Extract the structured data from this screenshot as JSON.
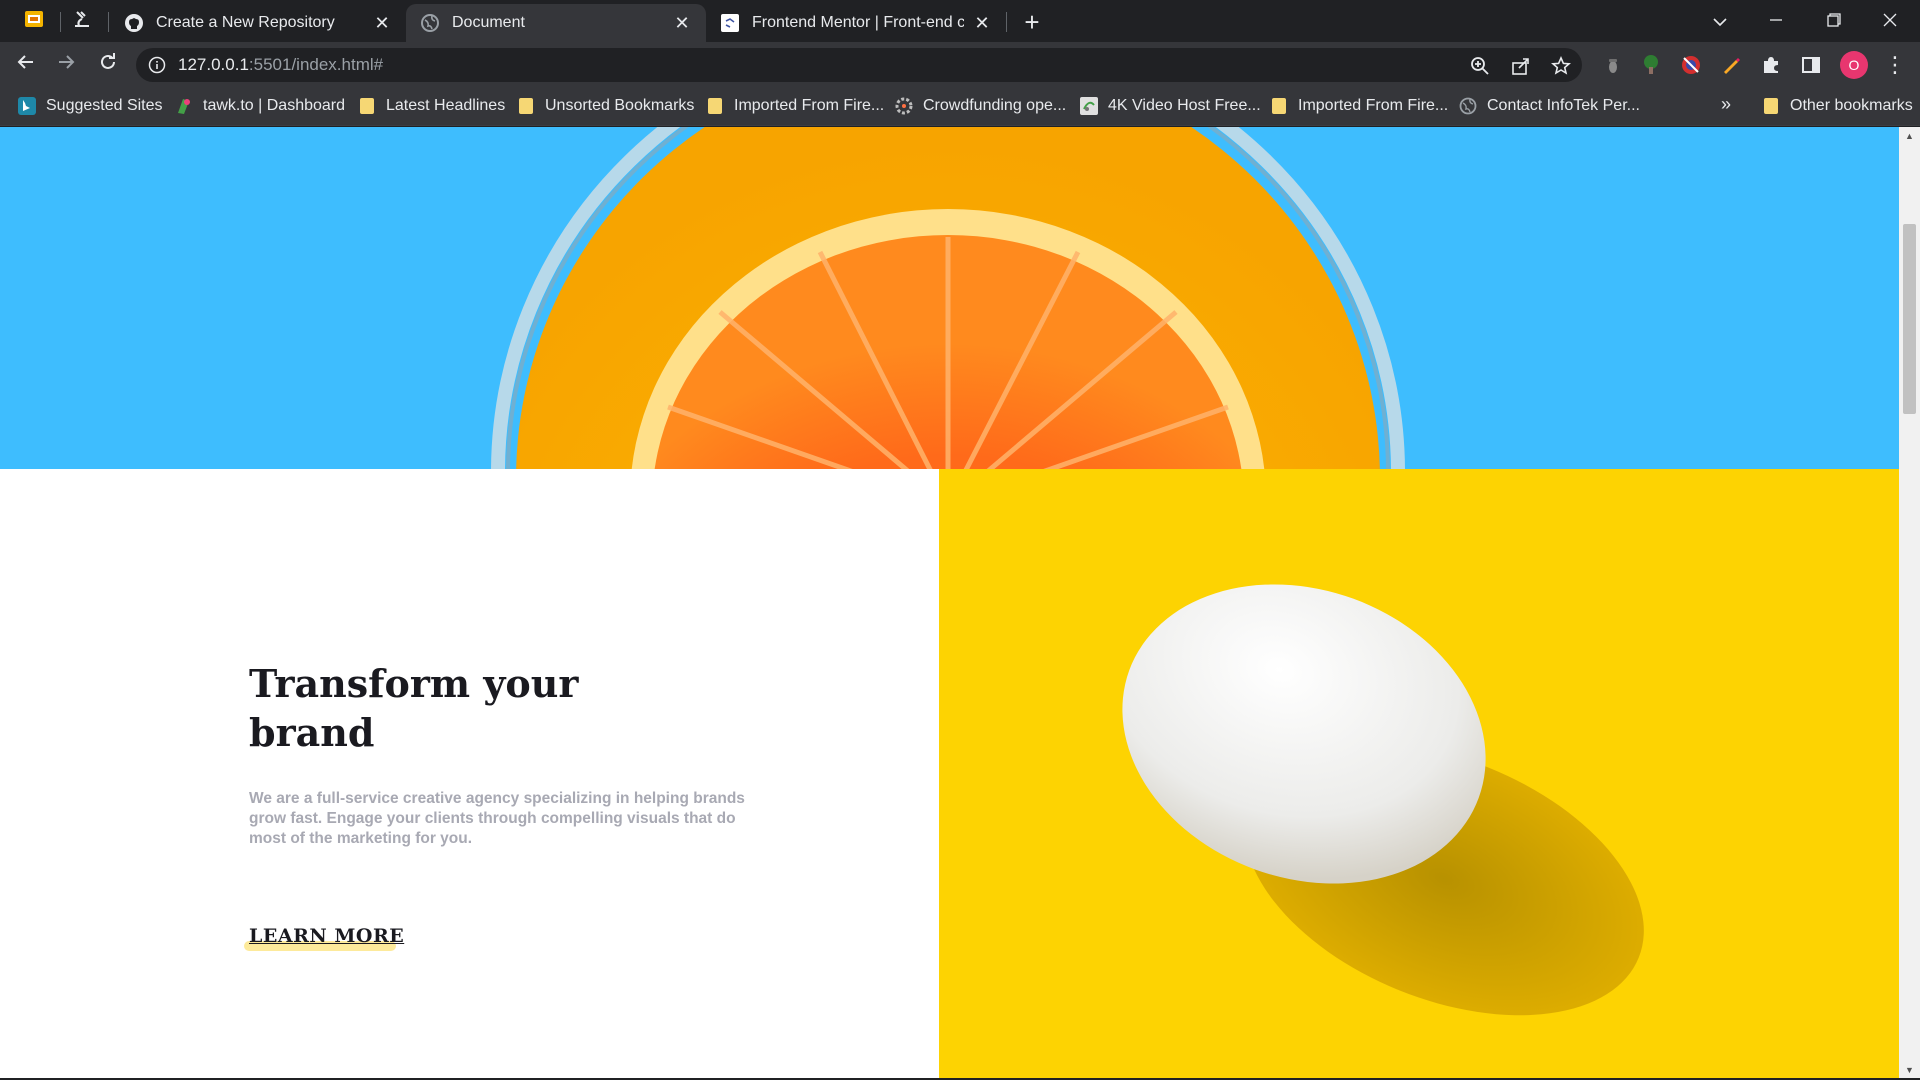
{
  "browser": {
    "tabs": [
      {
        "title": "Create a New Repository",
        "icon": "github-icon"
      },
      {
        "title": "Document",
        "icon": "globe-icon"
      },
      {
        "title": "Frontend Mentor | Front-end coc",
        "icon": "frontend-mentor-icon"
      }
    ],
    "url": {
      "host": "127.0.0.1",
      "rest": ":5501/index.html#"
    },
    "bookmarks": [
      {
        "label": "Suggested Sites",
        "icon": "bing-icon"
      },
      {
        "label": "tawk.to | Dashboard",
        "icon": "tawk-icon"
      },
      {
        "label": "Latest Headlines",
        "icon": "folder-icon"
      },
      {
        "label": "Unsorted Bookmarks",
        "icon": "folder-icon"
      },
      {
        "label": "Imported From Fire...",
        "icon": "folder-icon"
      },
      {
        "label": "Crowdfunding ope...",
        "icon": "crowdfunding-icon"
      },
      {
        "label": "4K Video Host Free...",
        "icon": "video-host-icon"
      },
      {
        "label": "Imported From Fire...",
        "icon": "folder-icon"
      },
      {
        "label": "Contact InfoTek Per...",
        "icon": "globe-icon"
      }
    ],
    "bookmarks_more": "»",
    "other_bookmarks": "Other bookmarks",
    "profile_initial": "O"
  },
  "page": {
    "heading": "Transform your brand",
    "paragraph": "We are a full-service creative agency specializing in helping brands grow fast. Engage your clients through compelling visuals that do most of the marketing for you.",
    "cta": "LEARN MORE"
  },
  "colors": {
    "hero_bg": "#3ebdfe",
    "yellow_bg": "#fdd302",
    "heading": "#1a1a20",
    "paragraph": "#a8a9b3",
    "cta_underline": "#fde68a"
  }
}
